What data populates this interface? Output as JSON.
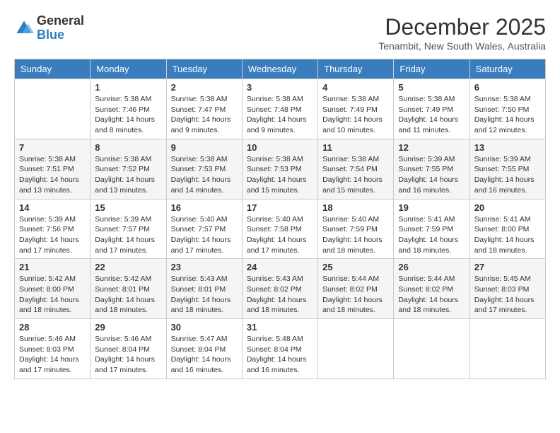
{
  "header": {
    "logo_line1": "General",
    "logo_line2": "Blue",
    "month_title": "December 2025",
    "location": "Tenambit, New South Wales, Australia"
  },
  "days_of_week": [
    "Sunday",
    "Monday",
    "Tuesday",
    "Wednesday",
    "Thursday",
    "Friday",
    "Saturday"
  ],
  "weeks": [
    [
      {
        "day": "",
        "sunrise": "",
        "sunset": "",
        "daylight": ""
      },
      {
        "day": "1",
        "sunrise": "Sunrise: 5:38 AM",
        "sunset": "Sunset: 7:46 PM",
        "daylight": "Daylight: 14 hours and 8 minutes."
      },
      {
        "day": "2",
        "sunrise": "Sunrise: 5:38 AM",
        "sunset": "Sunset: 7:47 PM",
        "daylight": "Daylight: 14 hours and 9 minutes."
      },
      {
        "day": "3",
        "sunrise": "Sunrise: 5:38 AM",
        "sunset": "Sunset: 7:48 PM",
        "daylight": "Daylight: 14 hours and 9 minutes."
      },
      {
        "day": "4",
        "sunrise": "Sunrise: 5:38 AM",
        "sunset": "Sunset: 7:49 PM",
        "daylight": "Daylight: 14 hours and 10 minutes."
      },
      {
        "day": "5",
        "sunrise": "Sunrise: 5:38 AM",
        "sunset": "Sunset: 7:49 PM",
        "daylight": "Daylight: 14 hours and 11 minutes."
      },
      {
        "day": "6",
        "sunrise": "Sunrise: 5:38 AM",
        "sunset": "Sunset: 7:50 PM",
        "daylight": "Daylight: 14 hours and 12 minutes."
      }
    ],
    [
      {
        "day": "7",
        "sunrise": "Sunrise: 5:38 AM",
        "sunset": "Sunset: 7:51 PM",
        "daylight": "Daylight: 14 hours and 13 minutes."
      },
      {
        "day": "8",
        "sunrise": "Sunrise: 5:38 AM",
        "sunset": "Sunset: 7:52 PM",
        "daylight": "Daylight: 14 hours and 13 minutes."
      },
      {
        "day": "9",
        "sunrise": "Sunrise: 5:38 AM",
        "sunset": "Sunset: 7:53 PM",
        "daylight": "Daylight: 14 hours and 14 minutes."
      },
      {
        "day": "10",
        "sunrise": "Sunrise: 5:38 AM",
        "sunset": "Sunset: 7:53 PM",
        "daylight": "Daylight: 14 hours and 15 minutes."
      },
      {
        "day": "11",
        "sunrise": "Sunrise: 5:38 AM",
        "sunset": "Sunset: 7:54 PM",
        "daylight": "Daylight: 14 hours and 15 minutes."
      },
      {
        "day": "12",
        "sunrise": "Sunrise: 5:39 AM",
        "sunset": "Sunset: 7:55 PM",
        "daylight": "Daylight: 14 hours and 16 minutes."
      },
      {
        "day": "13",
        "sunrise": "Sunrise: 5:39 AM",
        "sunset": "Sunset: 7:55 PM",
        "daylight": "Daylight: 14 hours and 16 minutes."
      }
    ],
    [
      {
        "day": "14",
        "sunrise": "Sunrise: 5:39 AM",
        "sunset": "Sunset: 7:56 PM",
        "daylight": "Daylight: 14 hours and 17 minutes."
      },
      {
        "day": "15",
        "sunrise": "Sunrise: 5:39 AM",
        "sunset": "Sunset: 7:57 PM",
        "daylight": "Daylight: 14 hours and 17 minutes."
      },
      {
        "day": "16",
        "sunrise": "Sunrise: 5:40 AM",
        "sunset": "Sunset: 7:57 PM",
        "daylight": "Daylight: 14 hours and 17 minutes."
      },
      {
        "day": "17",
        "sunrise": "Sunrise: 5:40 AM",
        "sunset": "Sunset: 7:58 PM",
        "daylight": "Daylight: 14 hours and 17 minutes."
      },
      {
        "day": "18",
        "sunrise": "Sunrise: 5:40 AM",
        "sunset": "Sunset: 7:59 PM",
        "daylight": "Daylight: 14 hours and 18 minutes."
      },
      {
        "day": "19",
        "sunrise": "Sunrise: 5:41 AM",
        "sunset": "Sunset: 7:59 PM",
        "daylight": "Daylight: 14 hours and 18 minutes."
      },
      {
        "day": "20",
        "sunrise": "Sunrise: 5:41 AM",
        "sunset": "Sunset: 8:00 PM",
        "daylight": "Daylight: 14 hours and 18 minutes."
      }
    ],
    [
      {
        "day": "21",
        "sunrise": "Sunrise: 5:42 AM",
        "sunset": "Sunset: 8:00 PM",
        "daylight": "Daylight: 14 hours and 18 minutes."
      },
      {
        "day": "22",
        "sunrise": "Sunrise: 5:42 AM",
        "sunset": "Sunset: 8:01 PM",
        "daylight": "Daylight: 14 hours and 18 minutes."
      },
      {
        "day": "23",
        "sunrise": "Sunrise: 5:43 AM",
        "sunset": "Sunset: 8:01 PM",
        "daylight": "Daylight: 14 hours and 18 minutes."
      },
      {
        "day": "24",
        "sunrise": "Sunrise: 5:43 AM",
        "sunset": "Sunset: 8:02 PM",
        "daylight": "Daylight: 14 hours and 18 minutes."
      },
      {
        "day": "25",
        "sunrise": "Sunrise: 5:44 AM",
        "sunset": "Sunset: 8:02 PM",
        "daylight": "Daylight: 14 hours and 18 minutes."
      },
      {
        "day": "26",
        "sunrise": "Sunrise: 5:44 AM",
        "sunset": "Sunset: 8:02 PM",
        "daylight": "Daylight: 14 hours and 18 minutes."
      },
      {
        "day": "27",
        "sunrise": "Sunrise: 5:45 AM",
        "sunset": "Sunset: 8:03 PM",
        "daylight": "Daylight: 14 hours and 17 minutes."
      }
    ],
    [
      {
        "day": "28",
        "sunrise": "Sunrise: 5:46 AM",
        "sunset": "Sunset: 8:03 PM",
        "daylight": "Daylight: 14 hours and 17 minutes."
      },
      {
        "day": "29",
        "sunrise": "Sunrise: 5:46 AM",
        "sunset": "Sunset: 8:04 PM",
        "daylight": "Daylight: 14 hours and 17 minutes."
      },
      {
        "day": "30",
        "sunrise": "Sunrise: 5:47 AM",
        "sunset": "Sunset: 8:04 PM",
        "daylight": "Daylight: 14 hours and 16 minutes."
      },
      {
        "day": "31",
        "sunrise": "Sunrise: 5:48 AM",
        "sunset": "Sunset: 8:04 PM",
        "daylight": "Daylight: 14 hours and 16 minutes."
      },
      {
        "day": "",
        "sunrise": "",
        "sunset": "",
        "daylight": ""
      },
      {
        "day": "",
        "sunrise": "",
        "sunset": "",
        "daylight": ""
      },
      {
        "day": "",
        "sunrise": "",
        "sunset": "",
        "daylight": ""
      }
    ]
  ]
}
